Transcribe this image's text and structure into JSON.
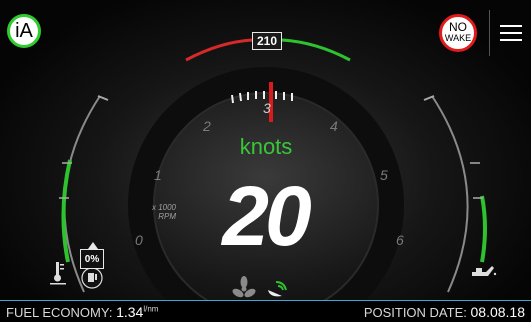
{
  "header": {
    "ia_badge": "iA",
    "nowake_line1": "NO",
    "nowake_line2": "WAKE",
    "setpoint": "210"
  },
  "gauge": {
    "rpm_ticks": [
      "0",
      "1",
      "2",
      "3",
      "4",
      "5",
      "6"
    ],
    "rpm_unit_line1": "x 1000",
    "rpm_unit_line2": "RPM",
    "speed_unit": "knots",
    "speed_value": "20",
    "rpm_value": 3.0,
    "colors": {
      "speed_unit": "#39c639",
      "needle": "#d81b1b",
      "arc_red": "#d62a2a",
      "arc_green": "#2ec22e"
    }
  },
  "left_gauge": {
    "fuel_percent": "0%",
    "icons": [
      "temperature-icon",
      "fuel-icon"
    ]
  },
  "right_gauge": {
    "icons": [
      "oil-can-icon"
    ]
  },
  "center_icons": [
    "fan-icon",
    "satellite-dish-icon"
  ],
  "status_bar": {
    "fuel_economy_label": "FUEL ECONOMY:",
    "fuel_economy_value": "1.34",
    "fuel_economy_unit": "l/nm",
    "position_date_label": "POSITION DATE:",
    "position_date_value": "08.08.18"
  }
}
